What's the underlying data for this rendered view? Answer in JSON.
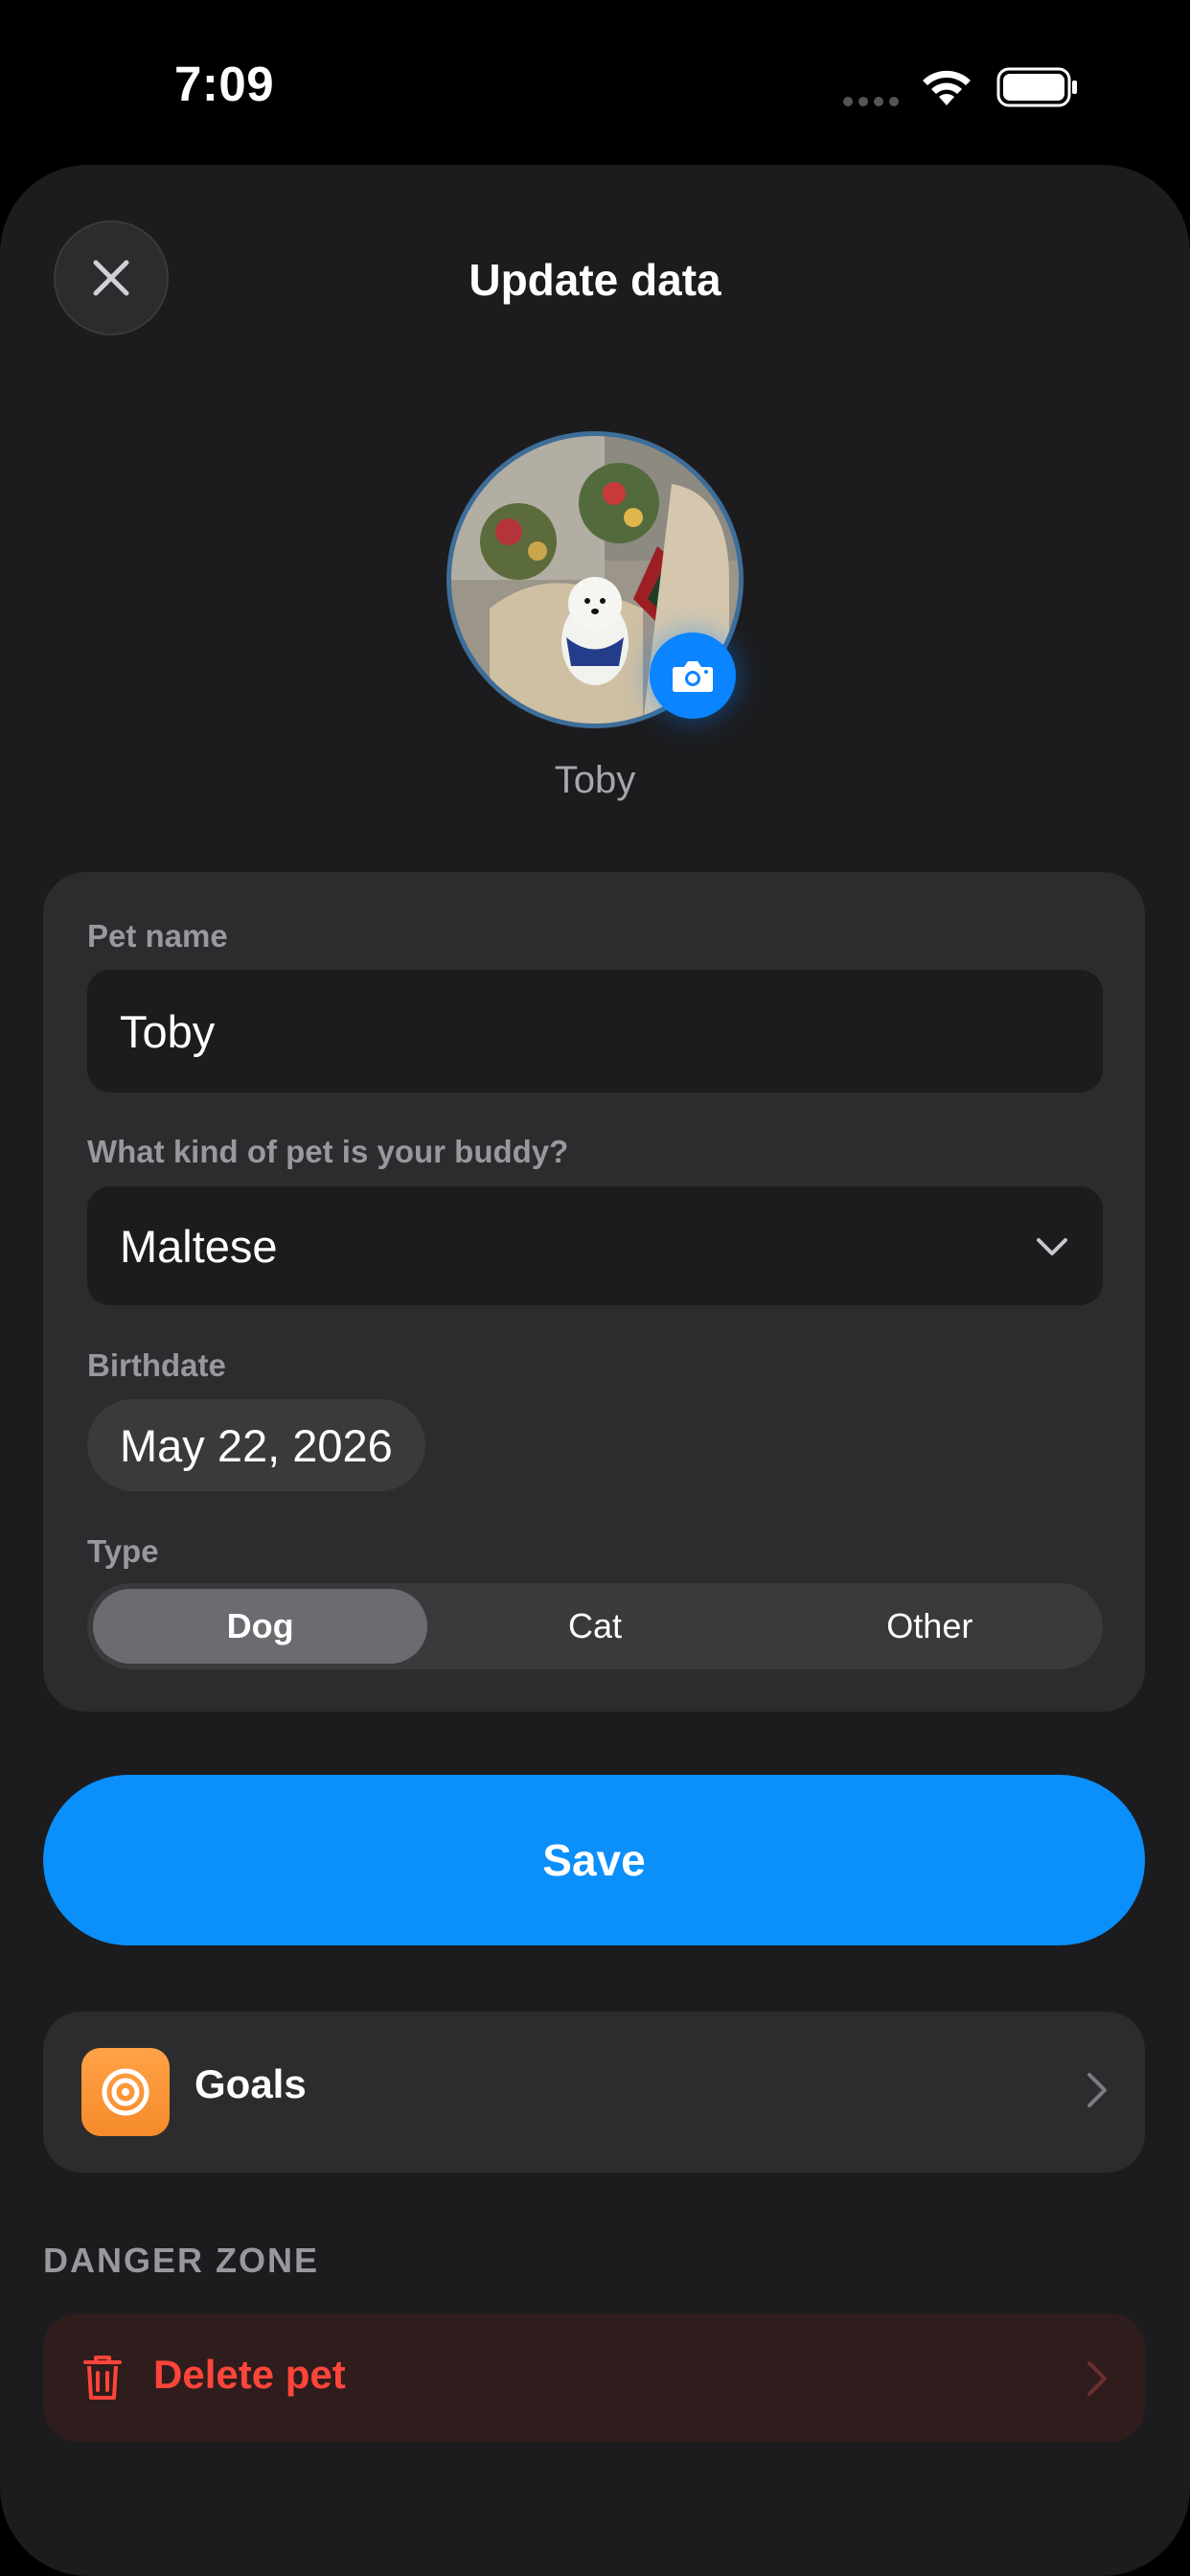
{
  "status_bar": {
    "time": "7:09"
  },
  "sheet": {
    "title": "Update data",
    "avatar_name": "Toby"
  },
  "form": {
    "pet_name": {
      "label": "Pet name",
      "value": "Toby"
    },
    "breed": {
      "label": "What kind of pet is your buddy?",
      "value": "Maltese"
    },
    "birthdate": {
      "label": "Birthdate",
      "value": "May 22, 2026"
    },
    "type": {
      "label": "Type",
      "options": [
        "Dog",
        "Cat",
        "Other"
      ],
      "selected": "Dog"
    }
  },
  "save_label": "Save",
  "goals": {
    "label": "Goals"
  },
  "danger_zone": {
    "label": "DANGER ZONE",
    "delete_label": "Delete pet"
  },
  "colors": {
    "accent": "#0a8ffb",
    "goals_icon": "#f68b2b",
    "danger": "#ff453a"
  }
}
